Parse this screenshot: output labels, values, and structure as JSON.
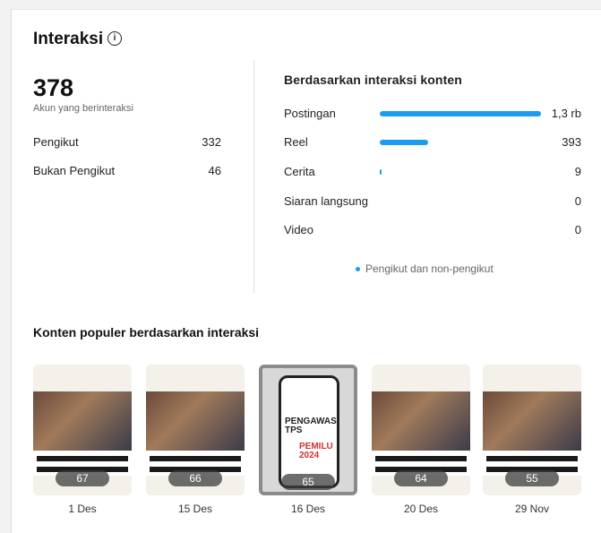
{
  "header": {
    "title": "Interaksi",
    "info_icon": "info-icon"
  },
  "summary": {
    "total": "378",
    "total_label": "Akun yang berinteraksi",
    "rows": [
      {
        "label": "Pengikut",
        "value": "332"
      },
      {
        "label": "Bukan Pengikut",
        "value": "46"
      }
    ]
  },
  "breakdown": {
    "title": "Berdasarkan interaksi konten",
    "rows": [
      {
        "label": "Postingan",
        "value": "1,3 rb",
        "level": 1.0
      },
      {
        "label": "Reel",
        "value": "393",
        "level": 0.3
      },
      {
        "label": "Cerita",
        "value": "9",
        "level": 0.01
      },
      {
        "label": "Siaran langsung",
        "value": "0",
        "level": 0
      },
      {
        "label": "Video",
        "value": "0",
        "level": 0
      }
    ],
    "legend": "Pengikut dan non-pengikut",
    "accent": "#1a9df1"
  },
  "popular": {
    "title": "Konten populer berdasarkan interaksi",
    "items": [
      {
        "count": "67",
        "date": "1 Des"
      },
      {
        "count": "66",
        "date": "15 Des"
      },
      {
        "count": "65",
        "date": "16 Des",
        "selected": true,
        "text_a": "PENGAWAS TPS",
        "text_b": "PEMILU 2024"
      },
      {
        "count": "64",
        "date": "20 Des"
      },
      {
        "count": "55",
        "date": "29 Nov"
      }
    ]
  }
}
